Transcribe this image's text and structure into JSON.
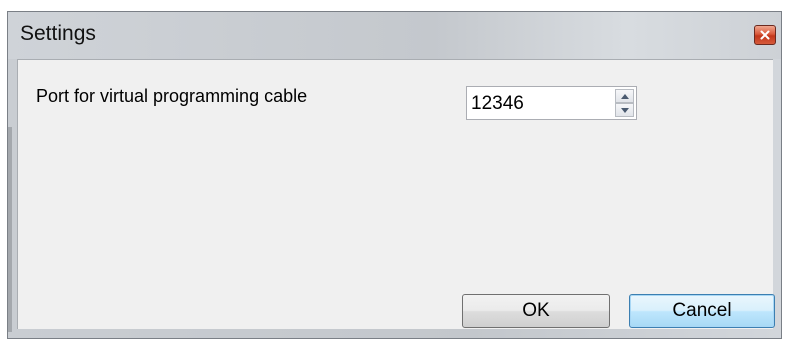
{
  "window": {
    "title": "Settings",
    "close_icon": "close-icon",
    "close_color": "#c2361b"
  },
  "form": {
    "port_label": "Port for virtual programming cable",
    "port_value": "12346",
    "spin_up_icon": "spin-up-arrow-icon",
    "spin_down_icon": "spin-down-arrow-icon"
  },
  "buttons": {
    "ok_label": "OK",
    "cancel_label": "Cancel"
  }
}
